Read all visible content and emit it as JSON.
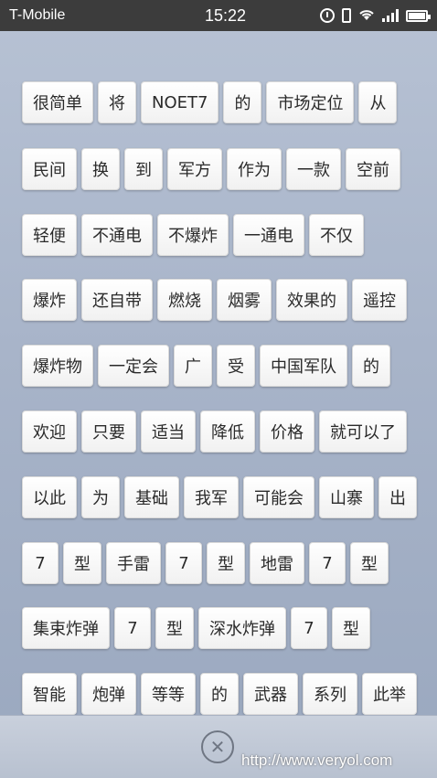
{
  "status_bar": {
    "carrier": "T-Mobile",
    "time": "15:22"
  },
  "rows": [
    [
      "很简单",
      "将",
      "NOET7",
      "的",
      "市场定位",
      "从"
    ],
    [
      "民间",
      "换",
      "到",
      "军方",
      "作为",
      "一款",
      "空前"
    ],
    [
      "轻便",
      "不通电",
      "不爆炸",
      "一通电",
      "不仅"
    ],
    [
      "爆炸",
      "还自带",
      "燃烧",
      "烟雾",
      "效果的",
      "遥控"
    ],
    [
      "爆炸物",
      "一定会",
      "广",
      "受",
      "中国军队",
      "的"
    ],
    [
      "欢迎",
      "只要",
      "适当",
      "降低",
      "价格",
      "就可以了"
    ],
    [
      "以此",
      "为",
      "基础",
      "我军",
      "可能会",
      "山寨",
      "出"
    ],
    [
      "7",
      "型",
      "手雷",
      "7",
      "型",
      "地雷",
      "7",
      "型"
    ],
    [
      "集束炸弹",
      "7",
      "型",
      "深水炸弹",
      "7",
      "型"
    ],
    [
      "智能",
      "炮弹",
      "等等",
      "的",
      "武器",
      "系列",
      "此举"
    ]
  ],
  "close_button": "✕",
  "watermark": "http://www.veryol.com"
}
